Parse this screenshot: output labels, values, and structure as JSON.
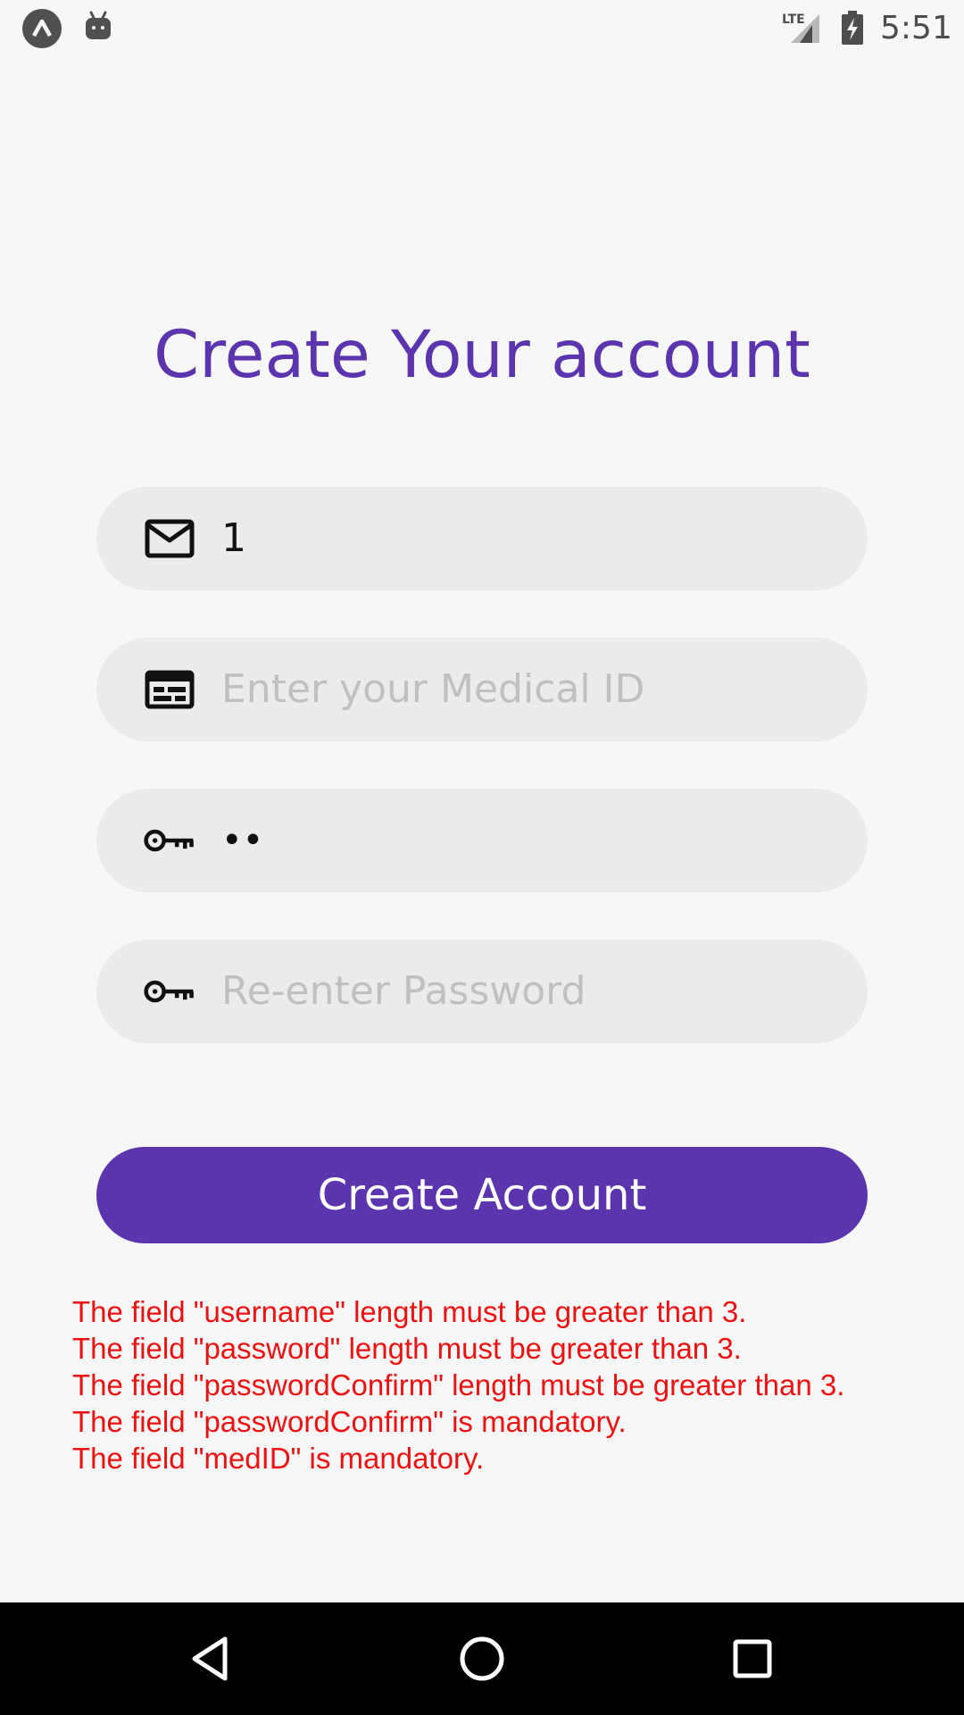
{
  "status_bar": {
    "time": "5:51",
    "network_label": "LTE",
    "icons": [
      "app-icon",
      "android-icon",
      "lte-signal-icon",
      "battery-charging-icon"
    ]
  },
  "page": {
    "title": "Create Your account"
  },
  "form": {
    "username": {
      "value": "1",
      "icon": "mail-icon"
    },
    "medical_id": {
      "value": "",
      "placeholder": "Enter your Medical ID",
      "icon": "id-card-icon"
    },
    "password": {
      "value": "••",
      "icon": "key-icon"
    },
    "password_confirm": {
      "value": "",
      "placeholder": "Re-enter Password",
      "icon": "key-icon"
    },
    "submit_label": "Create Account"
  },
  "errors": [
    "The field \"username\" length must be greater than 3.",
    "The field \"password\" length must be greater than 3.",
    "The field \"passwordConfirm\" length must be greater than 3.",
    "The field \"passwordConfirm\" is mandatory.",
    "The field \"medID\" is mandatory."
  ],
  "nav_bar": {
    "buttons": [
      "back-icon",
      "home-icon",
      "recents-icon"
    ]
  },
  "colors": {
    "accent": "#5a35ae",
    "error": "#ee1111",
    "field_bg": "#ebebeb",
    "page_bg": "#f7f7f7"
  }
}
